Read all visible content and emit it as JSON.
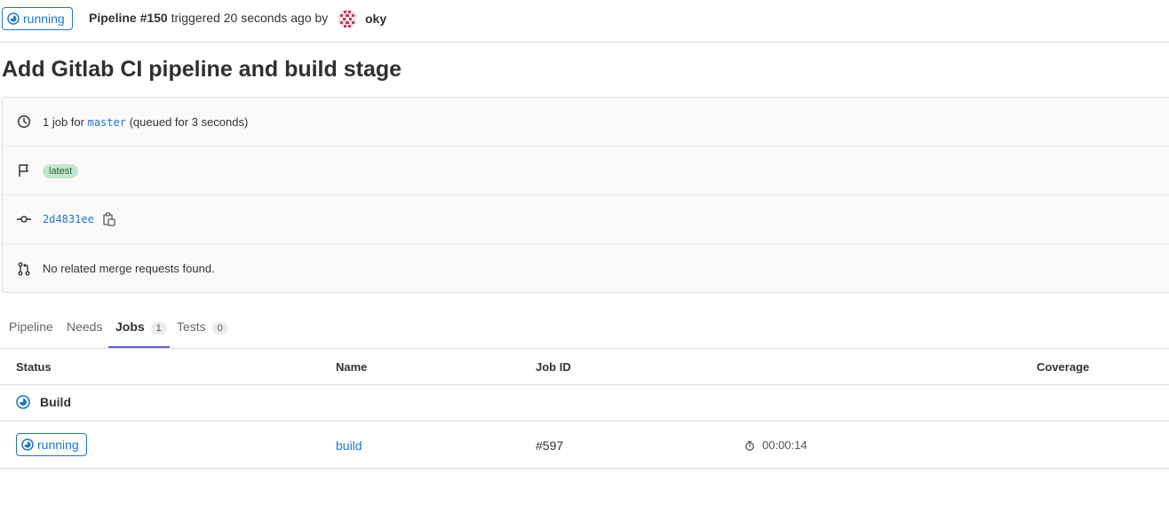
{
  "header": {
    "status": "running",
    "pipeline_label": "Pipeline #150",
    "triggered_text": "triggered 20 seconds ago by",
    "username": "oky"
  },
  "page_title": "Add Gitlab CI pipeline and build stage",
  "info": {
    "jobs_prefix": "1 job for",
    "branch": "master",
    "queued": "(queued for 3 seconds)",
    "tag": "latest",
    "commit_sha": "2d4831ee",
    "merge_requests": "No related merge requests found."
  },
  "tabs": [
    {
      "label": "Pipeline",
      "count": ""
    },
    {
      "label": "Needs",
      "count": ""
    },
    {
      "label": "Jobs",
      "count": "1"
    },
    {
      "label": "Tests",
      "count": "0"
    }
  ],
  "table": {
    "columns": [
      "Status",
      "Name",
      "Job ID",
      "Coverage"
    ],
    "stage": "Build",
    "jobs": [
      {
        "status": "running",
        "name": "build",
        "job_id": "#597",
        "duration": "00:00:14"
      }
    ]
  },
  "colors": {
    "running_blue": "#1f75cb",
    "tag_bg": "#c3e6cd",
    "tab_active_underline": "#6666c4"
  }
}
